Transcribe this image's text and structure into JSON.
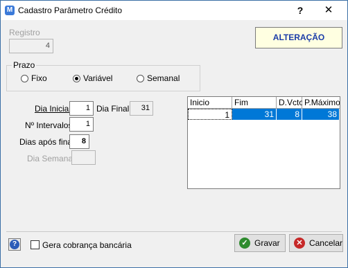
{
  "window": {
    "title": "Cadastro Parâmetro Crédito",
    "app_icon": "app-logo-icon",
    "help": "?",
    "close": "✕"
  },
  "registro": {
    "label": "Registro",
    "value": "4"
  },
  "status": {
    "label": "ALTERAÇÃO",
    "color": "#1a3ca8"
  },
  "prazo": {
    "label": "Prazo",
    "options": [
      {
        "label": "Fixo",
        "selected": false
      },
      {
        "label": "Variável",
        "selected": true
      },
      {
        "label": "Semanal",
        "selected": false
      }
    ]
  },
  "form": {
    "dia_inicial": {
      "label": "Dia Inicial",
      "value": "1"
    },
    "dia_final": {
      "label": "Dia Final",
      "value": "31"
    },
    "intervalos": {
      "label": "Nº Intervalos",
      "value": "1"
    },
    "dias_apos": {
      "label": "Dias após final",
      "value": "8"
    },
    "dia_semana": {
      "label": "Dia Semana",
      "value": ""
    }
  },
  "grid": {
    "columns": [
      "Inicio",
      "Fim",
      "D.Vcto",
      "P.Máximo"
    ],
    "rows": [
      [
        "1",
        "31",
        "8",
        "38"
      ]
    ]
  },
  "footer": {
    "checkbox_label": "Gera cobrança bancária",
    "save_label": "Gravar",
    "cancel_label": "Cancelar"
  }
}
